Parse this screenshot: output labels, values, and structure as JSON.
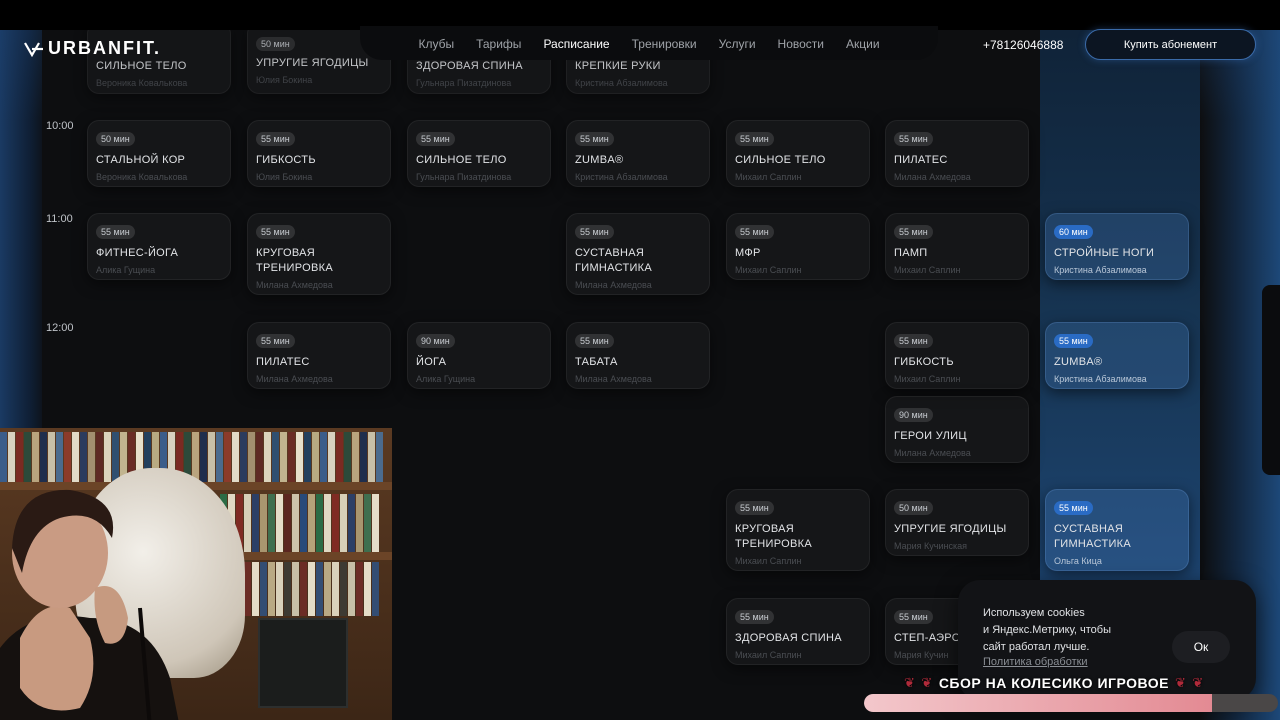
{
  "header": {
    "logo": "URBANFIT.",
    "nav": [
      "Клубы",
      "Тарифы",
      "Расписание",
      "Тренировки",
      "Услуги",
      "Новости",
      "Акции"
    ],
    "active_nav": "Расписание",
    "phone": "+78126046888",
    "buy_button": "Купить абонемент"
  },
  "schedule": {
    "times": [
      "10:00",
      "11:00",
      "12:00"
    ],
    "sessions": [
      {
        "duration": "",
        "title": "СИЛЬНОЕ ТЕЛО",
        "coach": "Вероника Ковалькова"
      },
      {
        "duration": "50 мин",
        "title": "УПРУГИЕ ЯГОДИЦЫ",
        "coach": "Юлия Бокина"
      },
      {
        "duration": "",
        "title": "ЗДОРОВАЯ СПИНА",
        "coach": "Гульнара Пизатдинова"
      },
      {
        "duration": "",
        "title": "КРЕПКИЕ РУКИ",
        "coach": "Кристина Абзалимова"
      },
      {
        "duration": "50 мин",
        "title": "СТАЛЬНОЙ КОР",
        "coach": "Вероника Ковалькова"
      },
      {
        "duration": "55 мин",
        "title": "ГИБКОСТЬ",
        "coach": "Юлия Бокина"
      },
      {
        "duration": "55 мин",
        "title": "СИЛЬНОЕ ТЕЛО",
        "coach": "Гульнара Пизатдинова"
      },
      {
        "duration": "55 мин",
        "title": "ZUMBA®",
        "coach": "Кристина Абзалимова"
      },
      {
        "duration": "55 мин",
        "title": "СИЛЬНОЕ ТЕЛО",
        "coach": "Михаил Саплин"
      },
      {
        "duration": "55 мин",
        "title": "ПИЛАТЕС",
        "coach": "Милана Ахмедова"
      },
      {
        "duration": "55 мин",
        "title": "ФИТНЕС-ЙОГА",
        "coach": "Алика Гущина"
      },
      {
        "duration": "55 мин",
        "title": "КРУГОВАЯ ТРЕНИРОВКА",
        "coach": "Милана Ахмедова"
      },
      {
        "duration": "55 мин",
        "title": "СУСТАВНАЯ ГИМНАСТИКА",
        "coach": "Милана Ахмедова"
      },
      {
        "duration": "55 мин",
        "title": "МФР",
        "coach": "Михаил Саплин"
      },
      {
        "duration": "55 мин",
        "title": "ПАМП",
        "coach": "Михаил Саплин"
      },
      {
        "duration": "60 мин",
        "title": "СТРОЙНЫЕ НОГИ",
        "coach": "Кристина Абзалимова"
      },
      {
        "duration": "55 мин",
        "title": "ПИЛАТЕС",
        "coach": "Милана Ахмедова"
      },
      {
        "duration": "90 мин",
        "title": "ЙОГА",
        "coach": "Алика Гущина"
      },
      {
        "duration": "55 мин",
        "title": "ТАБАТА",
        "coach": "Милана Ахмедова"
      },
      {
        "duration": "55 мин",
        "title": "ГИБКОСТЬ",
        "coach": "Михаил Саплин"
      },
      {
        "duration": "55 мин",
        "title": "ZUMBA®",
        "coach": "Кристина Абзалимова"
      },
      {
        "duration": "90 мин",
        "title": "ГЕРОИ УЛИЦ",
        "coach": "Милана Ахмедова"
      },
      {
        "duration": "55 мин",
        "title": "КРУГОВАЯ ТРЕНИРОВКА",
        "coach": "Михаил Саплин"
      },
      {
        "duration": "50 мин",
        "title": "УПРУГИЕ ЯГОДИЦЫ",
        "coach": "Мария Кучинская"
      },
      {
        "duration": "55 мин",
        "title": "СУСТАВНАЯ ГИМНАСТИКА",
        "coach": "Ольга Кица"
      },
      {
        "duration": "55 мин",
        "title": "ЗДОРОВАЯ СПИНА",
        "coach": "Михаил Саплин"
      },
      {
        "duration": "55 мин",
        "title": "СТЕП-АЭРО",
        "coach": "Мария Кучин"
      }
    ]
  },
  "cookie": {
    "line1": "Используем cookies",
    "line2": "и Яндекс.Метрику, чтобы",
    "line3": "сайт работал лучше.",
    "link": "Политика обработки",
    "ok": "Ок"
  },
  "overlay": {
    "ticker": "СБОР НА КОЛЕСИКО ИГРОВОЕ",
    "progress": 0.84
  },
  "colors": {
    "accent": "#2a6bc4",
    "highlight_column": "#173655"
  }
}
